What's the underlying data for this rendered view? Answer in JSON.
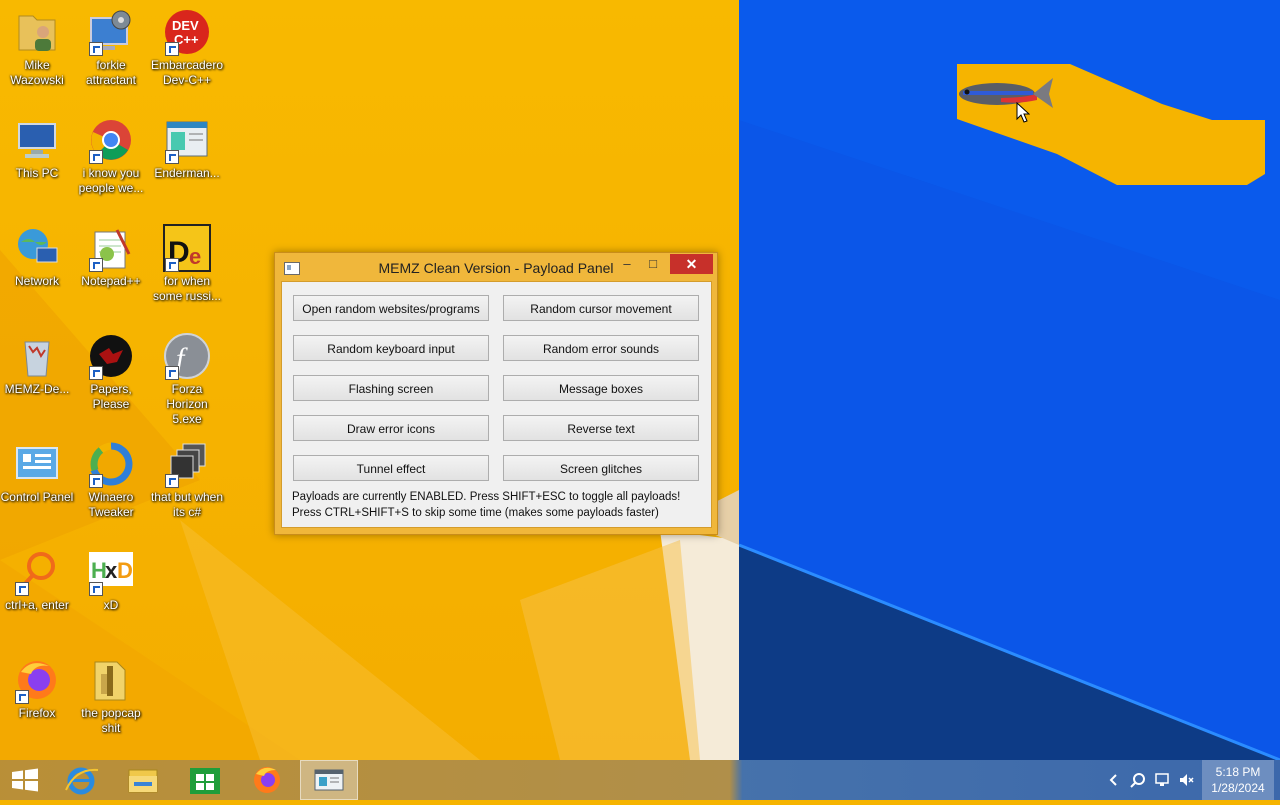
{
  "desktop_icons": [
    {
      "id": "mike",
      "label": "Mike Wazowski",
      "icon": "folder-user-icon"
    },
    {
      "id": "forkie",
      "label": "forkie attractant",
      "icon": "monitor-gear-icon"
    },
    {
      "id": "devcpp",
      "label": "Embarcadero Dev-C++",
      "icon": "devcpp-icon"
    },
    {
      "id": "thispc",
      "label": "This PC",
      "icon": "computer-icon"
    },
    {
      "id": "chrome",
      "label": "i know you people we...",
      "icon": "chrome-icon"
    },
    {
      "id": "enderman",
      "label": "Enderman...",
      "icon": "window-app-icon"
    },
    {
      "id": "network",
      "label": "Network",
      "icon": "network-globe-icon"
    },
    {
      "id": "notepadpp",
      "label": "Notepad++",
      "icon": "notepadpp-icon"
    },
    {
      "id": "russi",
      "label": "for when some russi...",
      "icon": "de-app-icon"
    },
    {
      "id": "memz",
      "label": "MEMZ-De...",
      "icon": "recycle-bin-icon"
    },
    {
      "id": "papers",
      "label": "Papers, Please",
      "icon": "papers-please-icon"
    },
    {
      "id": "forza",
      "label": "Forza Horizon 5.exe",
      "icon": "flash-icon"
    },
    {
      "id": "controlpanel",
      "label": "Control Panel",
      "icon": "control-panel-icon"
    },
    {
      "id": "winaero",
      "label": "Winaero Tweaker",
      "icon": "winaero-icon"
    },
    {
      "id": "cs",
      "label": "that but when its c#",
      "icon": "stacked-windows-icon"
    },
    {
      "id": "ctrla",
      "label": "ctrl+a, enter",
      "icon": "search-ring-icon"
    },
    {
      "id": "xd",
      "label": "xD",
      "icon": "hxd-icon"
    },
    {
      "id": "firefox",
      "label": "Firefox",
      "icon": "firefox-icon"
    },
    {
      "id": "popcap",
      "label": "the popcap shit",
      "icon": "folder-zip-icon"
    }
  ],
  "window": {
    "title": "MEMZ Clean Version - Payload Panel",
    "minimize": "–",
    "maximize": "□",
    "close": "✕",
    "buttons": [
      "Open random websites/programs",
      "Random cursor movement",
      "Random keyboard input",
      "Random error sounds",
      "Flashing screen",
      "Message boxes",
      "Draw error icons",
      "Reverse text",
      "Tunnel effect",
      "Screen glitches"
    ],
    "info_line1": "Payloads are currently ENABLED. Press SHIFT+ESC to toggle all payloads!",
    "info_line2": "Press CTRL+SHIFT+S to skip some time (makes some payloads faster)"
  },
  "taskbar": {
    "items": [
      "windows-start-icon",
      "internet-explorer-icon",
      "file-explorer-icon",
      "store-icon",
      "firefox-icon",
      "memz-window-icon"
    ],
    "tray": [
      "chevron-icon",
      "search-icon",
      "network-icon",
      "volume-muted-icon"
    ],
    "time": "5:18 PM",
    "date": "1/28/2024"
  },
  "colors": {
    "wallpaper_left": "#f6b400",
    "wallpaper_right": "#0b56e8",
    "window_frame": "#f0b73b",
    "close": "#c7302a"
  }
}
